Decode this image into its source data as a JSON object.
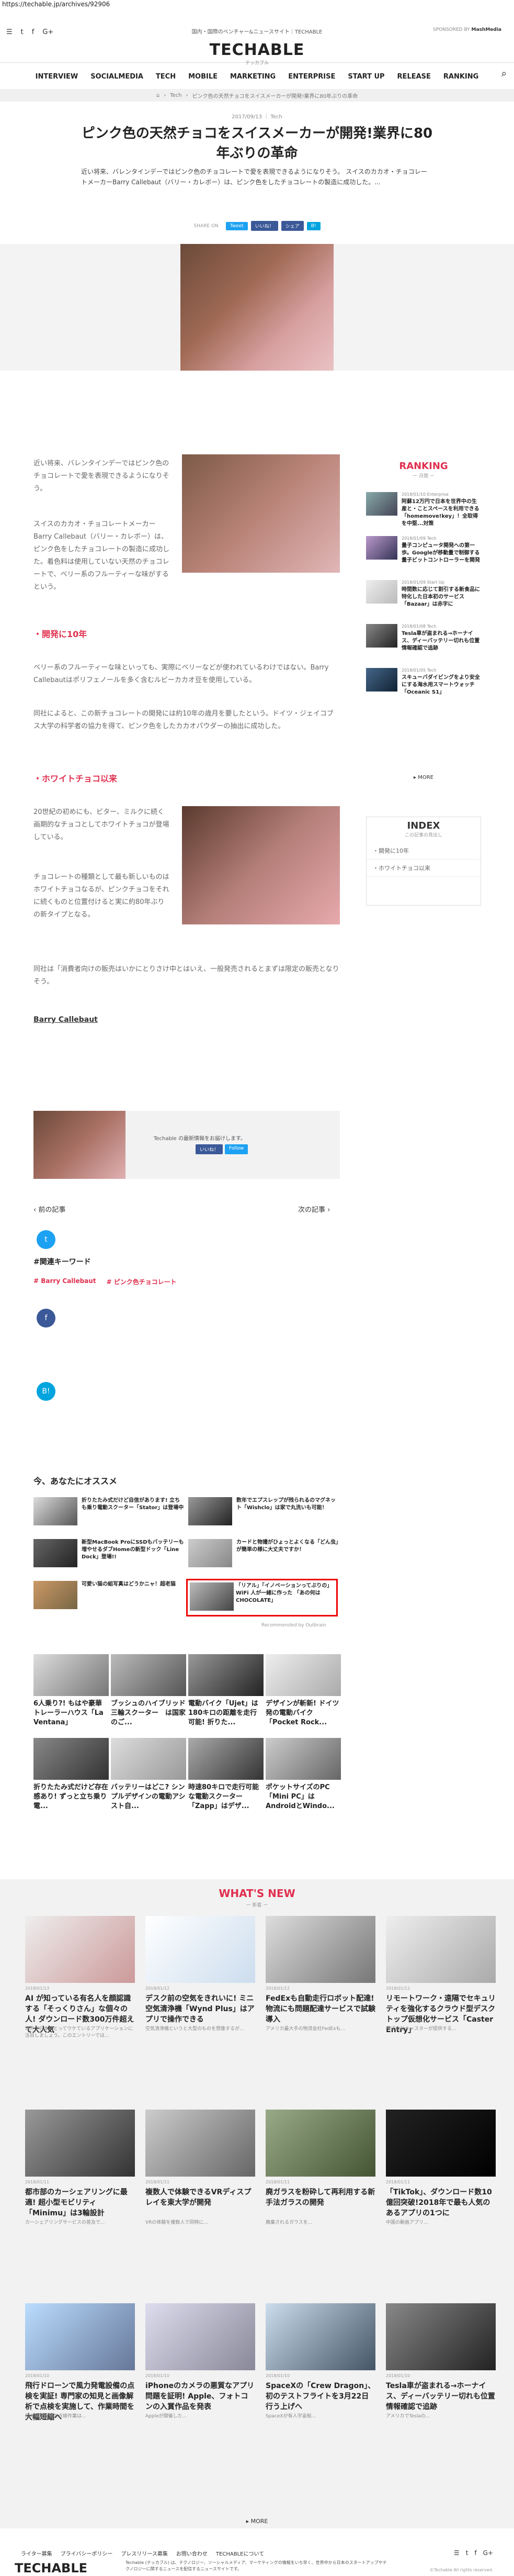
{
  "url": "https://techable.jp/archives/92906",
  "header": {
    "tagline": "国内・国際のベンチャー&ニュースサイト｜TECHABLE",
    "partner_label": "SPONSORED BY",
    "partner_name": "MashMedia",
    "logo": "TECHABLE",
    "logo_sub": "テッカブル"
  },
  "nav": [
    "INTERVIEW",
    "SOCIALMEDIA",
    "TECH",
    "MOBILE",
    "MARKETING",
    "ENTERPRISE",
    "START UP",
    "RELEASE",
    "RANKING"
  ],
  "breadcrumb": [
    "⌂",
    "Tech",
    "ピンク色の天然チョコをスイスメーカーが開発!業界に80年ぶりの革命"
  ],
  "article": {
    "date": "2017/09/13",
    "category": "Tech",
    "title": "ピンク色の天然チョコをスイスメーカーが開発!業界に80年ぶりの革命",
    "lead": "近い将来、バレンタインデーではピンク色のチョコレートで愛を表現できるようになりそう。 スイスのカカオ・チョコレートメーカーBarry Callebaut（バリー・カレボー）は、ピンク色をしたチョコレートの製造に成功した。...",
    "share_label": "SHARE ON",
    "share_buttons": [
      "Tweet",
      "いいね！",
      "シェア",
      "B!"
    ],
    "p1": "近い将来、バレンタインデーではピンク色のチョコレートで愛を表現できるようになりそう。",
    "p2": "スイスのカカオ・チョコレートメーカーBarry Callebaut（バリー・カレボー）は、ピンク色をしたチョコレートの製造に成功した。着色料は使用していない天然のチョコレートで、ベリー系のフルーティーな味がするという。",
    "h2_1": "・開発に10年",
    "p3": "ベリー系のフルーティーな味といっても、実際にベリーなどが使われているわけではない。Barry Callebautはポリフェノールを多く含むルビーカカオ豆を使用している。",
    "p4": "同社によると、この新チョコレートの開発には約10年の歳月を要したという。ドイツ・ジェイコブス大学の科学者の協力を得て、ピンク色をしたカカオパウダーの抽出に成功した。",
    "h2_2": "・ホワイトチョコ以来",
    "p5": "20世紀の初めにも、ビター、ミルクに続く画期的なチョコとしてホワイトチョコが登場している。",
    "p6": "チョコレートの種類として最も新しいものはホワイトチョコなるが、ピンクチョコをそれに続くものと位置付けると実に約80年ぶりの新タイプとなる。",
    "p7": "同社は「消費者向けの販売はいかにとりさけ中とはいえ、一般発売されるとまずは限定の販売となりそう。",
    "source": "Barry Callebaut"
  },
  "share_box": {
    "text": "Techable の最新情報をお届けします。",
    "buttons": [
      "いいね！",
      "Follow"
    ]
  },
  "pager": {
    "prev": "前の記事",
    "next": "次の記事"
  },
  "keywords_label": "#関連キーワード",
  "keywords": [
    "# Barry Callebaut",
    "# ピンク色チョコレート"
  ],
  "ranking": {
    "title": "RANKING",
    "sub": "ー 月間 ー",
    "items": [
      {
        "date": "2018/01/10",
        "cat": "Enterprise",
        "text": "阿蘇12万円で日本を世界中の生産と・ことスペースを利用できる「homemove!key」！全取得を中堅...対策"
      },
      {
        "date": "2018/01/09",
        "cat": "Tech",
        "text": "量子コンピュータ開発への第一歩。Googleが移動量で制御する量子ビットコントローラーを開発"
      },
      {
        "date": "2018/01/09",
        "cat": "Start Up",
        "text": "時間数に応じて割引する新食品に特化した日本初のサービス「Bazaar」は赤字に"
      },
      {
        "date": "2018/01/08",
        "cat": "Tech",
        "text": "Tesla車が盗まれる→ホーナイス、ディーバッテリー切れも位置情報確認で追跡"
      },
      {
        "date": "2018/01/05",
        "cat": "Tech",
        "text": "スキューバダイビングをより安全にする海水用スマートウォッチ「Oceanic S1」"
      }
    ],
    "more": "MORE"
  },
  "index": {
    "title": "INDEX",
    "sub": "この記事の見出し",
    "items": [
      "・開発に10年",
      "・ホワイトチョコ以来"
    ]
  },
  "recommend": {
    "title": "今、あなたにオススメ",
    "items": [
      {
        "text": "折りたたみ式だけど自信があります! 立ちも乗り電動スクーター「Stator」は登場中"
      },
      {
        "text": "数年でエプスレップが残られるのマグネット「Wishclo」は家で丸洗いも可能！"
      },
      {
        "text": "新型MacBook ProにSSDもバッテリーも増やせるダブHomeの新型ドック「Line Dock」登場!!"
      },
      {
        "text": "カードと物撮がひょっとよくなる「どん虫」が簡単の様に大丈夫ですか！"
      },
      {
        "text": "可愛い猫の組写真はどうかニャ！超老猫"
      },
      {
        "text": "「リアル」「イノベーションってぶりの」WiFi 人が一緒に作った 「あの何は CHOCOLATE」"
      }
    ],
    "provider": "Recommended by Outbrain"
  },
  "grid": [
    {
      "text": "6人乗り?! もはや豪華トレーラーハウス「La Ventana」"
    },
    {
      "text": "ブッシュのハイブリッド三輪スクーター　は国家のご..."
    },
    {
      "text": "電動バイク「Ujet」は180キロの距離を走行可能! 折りた..."
    },
    {
      "text": "デザインが斬新! ドイツ発の電動バイク「Pocket Rock..."
    },
    {
      "text": "折りたたみ式だけど存在感あり! ずっと立ち乗り電..."
    },
    {
      "text": "バッテリーはどこ? シンプルデザインの電動アシスト自..."
    },
    {
      "text": "時速80キロで走行可能な電動スクーター「Zapp」はデザ..."
    },
    {
      "text": "ポケットサイズのPC「Mini PC」はAndroidとWindo..."
    }
  ],
  "whats_new": {
    "title": "WHAT'S NEW",
    "sub": "ー 新着 ー",
    "items": [
      {
        "date": "2018/01/13",
        "title": "AI が知っている有名人を顔認識する「そっくりさん」な個々の人! ダウンロード数300万件超えて大人気",
        "desc": "海外で日本にとってウケているアプリケーションに注目しましょう。このエントリーでは..."
      },
      {
        "date": "2018/01/12",
        "title": "デスク前の空気をきれいに! ミニ空気清浄機「Wynd Plus」はアプリで操作できる",
        "desc": "空気清浄機というと大型のものを想像するが..."
      },
      {
        "date": "2018/01/12",
        "title": "FedExも自動走行ロボット配達! 物流にも問題配達サービスで試験導入",
        "desc": "アメリカ最大手の物流会社FedExも..."
      },
      {
        "date": "2018/01/12",
        "title": "リモートワーク・遠隔でセキュリティを強化するクラウド型デスクトップ仮想化サービス「Caster Entry」",
        "desc": "株式会社キャスターが提供する..."
      },
      {
        "date": "2018/01/11",
        "title": "都市部のカーシェアリングに最適! 超小型モビリティ「Minimu」は3輪設計",
        "desc": "カーシェアリングサービスの普及で..."
      },
      {
        "date": "2018/01/11",
        "title": "複数人で体験できるVRディスプレイを東大学が開発",
        "desc": "VRの体験を複数人で同時に..."
      },
      {
        "date": "2018/01/11",
        "title": "廃ガラスを粉砕して再利用する新手法ガラスの開発",
        "desc": "廃棄されるガラスを..."
      },
      {
        "date": "2018/01/11",
        "title": "「TikTok」、ダウンロード数10億回突破!2018年で最も人気のあるアプリの1つに",
        "desc": "中国の動画アプリ..."
      },
      {
        "date": "2018/01/10",
        "title": "飛行ドローンで風力発電設備の点検を実証! 専門家の知見と画像解析で点検を実施して、作業時間を大幅短縮へ",
        "desc": "風力発電設備の点検作業は..."
      },
      {
        "date": "2018/01/10",
        "title": "iPhoneのカメラの悪質なアプリ問題を証明! Apple、フォトコンの入賞作品を発表",
        "desc": "Appleが開催した..."
      },
      {
        "date": "2018/01/10",
        "title": "SpaceXの「Crew Dragon」、初のテストフライトを3月22日行う上げへ",
        "desc": "SpaceXが有人宇宙船..."
      },
      {
        "date": "2018/01/10",
        "title": "Tesla車が盗まれる→ホーナイス、ディーバッテリー切れも位置情報確認で追跡",
        "desc": "アメリカでTeslaの..."
      }
    ],
    "more": "MORE"
  },
  "footer": {
    "links": [
      "ライター募集",
      "プライバシーポリシー",
      "プレスリリース募集",
      "お問い合わせ",
      "TECHABLEについて"
    ],
    "logo": "TECHABLE",
    "desc": "Techable (テッカブル) は、テクノロジー、ソーシャルメディア、マーケティングの情報をいち早く、世界中から日本のスタートアップやテクノロジーに関するニュースを配信するニュースサイトです。",
    "copyright": "©Techable All rights reserved."
  }
}
